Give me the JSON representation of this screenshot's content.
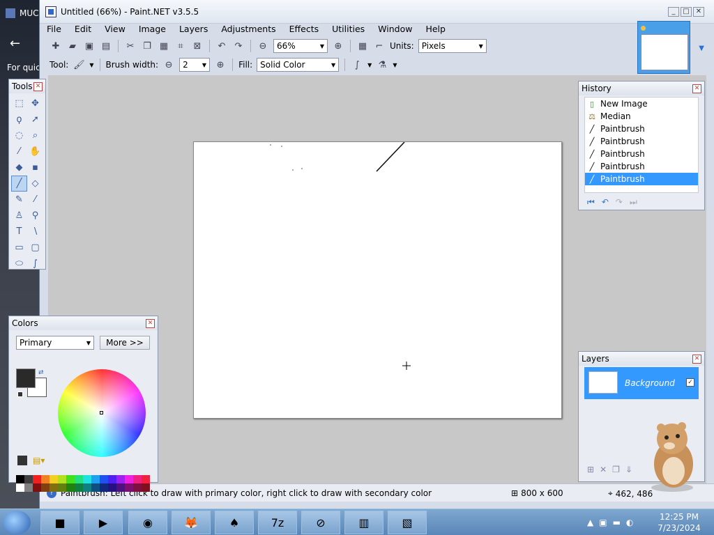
{
  "background_app": {
    "title": "MUC",
    "hint": "For quick"
  },
  "window": {
    "title": "Untitled (66%) - Paint.NET v3.5.5",
    "controls": [
      "_",
      "□",
      "✕"
    ]
  },
  "menu": [
    "File",
    "Edit",
    "View",
    "Image",
    "Layers",
    "Adjustments",
    "Effects",
    "Utilities",
    "Window",
    "Help"
  ],
  "toolbar": {
    "zoom_value": "66%",
    "units_label": "Units:",
    "units_value": "Pixels",
    "tool_label": "Tool:",
    "brush_width_label": "Brush width:",
    "brush_width_value": "2",
    "fill_label": "Fill:",
    "fill_value": "Solid Color"
  },
  "tools_panel": {
    "title": "Tools"
  },
  "colors_panel": {
    "title": "Colors",
    "mode": "Primary",
    "more_label": "More >>",
    "primary_color": "#2a2a2a",
    "secondary_color": "#ffffff"
  },
  "history_panel": {
    "title": "History",
    "items": [
      {
        "label": "New Image",
        "icon": "new-image-icon",
        "selected": false
      },
      {
        "label": "Median",
        "icon": "median-icon",
        "selected": false
      },
      {
        "label": "Paintbrush",
        "icon": "paintbrush-icon",
        "selected": false
      },
      {
        "label": "Paintbrush",
        "icon": "paintbrush-icon",
        "selected": false
      },
      {
        "label": "Paintbrush",
        "icon": "paintbrush-icon",
        "selected": false
      },
      {
        "label": "Paintbrush",
        "icon": "paintbrush-icon",
        "selected": false
      },
      {
        "label": "Paintbrush",
        "icon": "paintbrush-icon",
        "selected": true
      }
    ]
  },
  "layers_panel": {
    "title": "Layers",
    "layer_name": "Background"
  },
  "status": {
    "help_text": "Paintbrush: Left click to draw with primary color, right click to draw with secondary color",
    "image_size": "800 x 600",
    "cursor_pos": "462, 486"
  },
  "taskbar": {
    "time": "12:25 PM",
    "date": "7/23/2024"
  }
}
